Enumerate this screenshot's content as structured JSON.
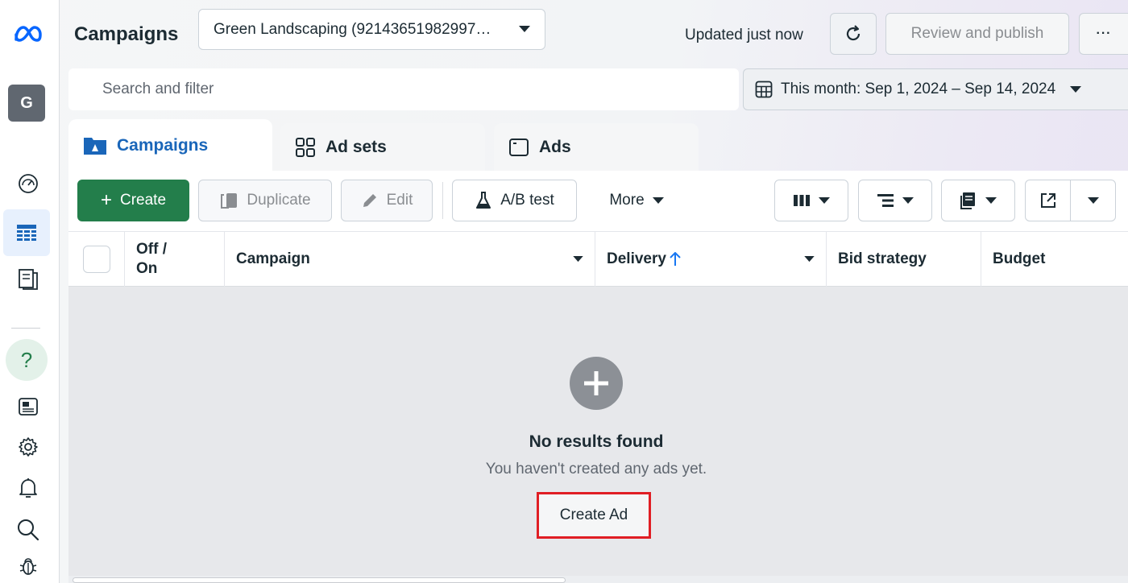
{
  "header": {
    "title": "Campaigns",
    "account": "Green Landscaping (92143651982997…",
    "updated": "Updated just now",
    "review_publish": "Review and publish",
    "more": "···"
  },
  "rail": {
    "avatar_initial": "G",
    "help": "?"
  },
  "search": {
    "placeholder": "Search and filter"
  },
  "date_range": {
    "label": "This month: Sep 1, 2024 – Sep 14, 2024"
  },
  "tabs": [
    {
      "label": "Campaigns",
      "active": true
    },
    {
      "label": "Ad sets",
      "active": false
    },
    {
      "label": "Ads",
      "active": false
    }
  ],
  "toolbar": {
    "create": "Create",
    "duplicate": "Duplicate",
    "edit": "Edit",
    "ab_test": "A/B test",
    "more": "More"
  },
  "table": {
    "columns": {
      "off_on_line1": "Off /",
      "off_on_line2": "On",
      "campaign": "Campaign",
      "delivery": "Delivery",
      "bid_strategy": "Bid strategy",
      "budget": "Budget"
    }
  },
  "empty_state": {
    "title": "No results found",
    "subtitle": "You haven't created any ads yet.",
    "button": "Create Ad"
  },
  "colors": {
    "create_green": "#237e4b",
    "active_tab_blue": "#1a66b9",
    "highlight_red": "#e01e24"
  }
}
